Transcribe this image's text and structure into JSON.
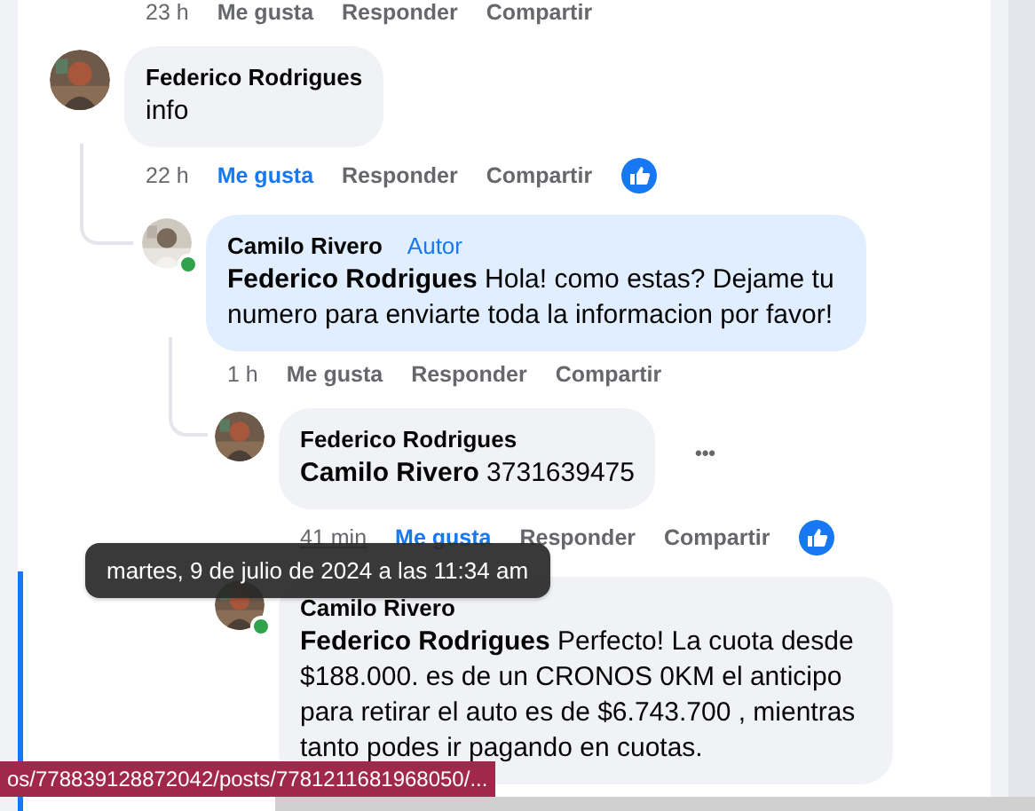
{
  "previous_comment": {
    "time": "23 h",
    "actions": {
      "like": "Me gusta",
      "reply": "Responder",
      "share": "Compartir"
    },
    "liked": false
  },
  "comments": [
    {
      "author": "Federico Rodrigues",
      "highlighted": false,
      "text": "info",
      "time": "22 h",
      "time_hovered": false,
      "actions": {
        "like": "Me gusta",
        "reply": "Responder",
        "share": "Compartir"
      },
      "liked": true,
      "reaction": true,
      "children": [
        {
          "author": "Camilo Rivero",
          "badge": "Autor",
          "online": true,
          "highlighted": true,
          "mention": "Federico Rodrigues",
          "text": "Hola! como estas? Dejame tu numero para enviarte toda la informacion por favor!",
          "time": "1 h",
          "time_hovered": false,
          "actions": {
            "like": "Me gusta",
            "reply": "Responder",
            "share": "Compartir"
          },
          "liked": false,
          "children": [
            {
              "author": "Federico Rodrigues",
              "highlighted": false,
              "mention": "Camilo Rivero",
              "text": "3731639475",
              "more": "•••",
              "time": "41 min",
              "time_hovered": true,
              "actions": {
                "like": "Me gusta",
                "reply": "Responder",
                "share": "Compartir"
              },
              "liked": true,
              "reaction": true
            },
            {
              "author": "Camilo Rivero",
              "online": true,
              "highlighted": false,
              "mention": "Federico Rodrigues",
              "text": "Perfecto! La cuota desde $188.000. es de un CRONOS 0KM el anticipo para retirar el auto es de $6.743.700 , mientras tanto podes ir pagando en cuotas."
            }
          ]
        }
      ]
    }
  ],
  "tooltip": "martes, 9 de julio de 2024 a las 11:34 am",
  "status_bar": {
    "url": "os/778839128872042/posts/7781211681968050/..."
  }
}
